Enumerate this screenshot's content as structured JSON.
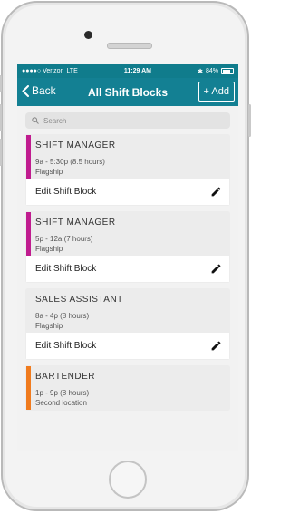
{
  "status_bar": {
    "carrier": "●●●●○ Verizon",
    "network": "LTE",
    "time": "11:29 AM",
    "bluetooth": "✱",
    "battery_pct": "84%"
  },
  "nav": {
    "back_label": "Back",
    "title": "All Shift Blocks",
    "add_label": "+ Add"
  },
  "search": {
    "placeholder": "Search"
  },
  "shift_blocks": [
    {
      "role": "SHIFT MANAGER",
      "hours": "9a - 5:30p (8.5 hours)",
      "location": "Flagship",
      "color": "#c01c8f",
      "edit_label": "Edit Shift Block"
    },
    {
      "role": "SHIFT MANAGER",
      "hours": "5p - 12a (7 hours)",
      "location": "Flagship",
      "color": "#c01c8f",
      "edit_label": "Edit Shift Block"
    },
    {
      "role": "SALES ASSISTANT",
      "hours": "8a - 4p (8 hours)",
      "location": "Flagship",
      "color": "#ececec",
      "edit_label": "Edit Shift Block"
    },
    {
      "role": "BARTENDER",
      "hours": "1p - 9p (8 hours)",
      "location": "Second location",
      "color": "#f07b1e",
      "edit_label": ""
    }
  ],
  "colors": {
    "header": "#138093",
    "status": "#107c8c"
  }
}
